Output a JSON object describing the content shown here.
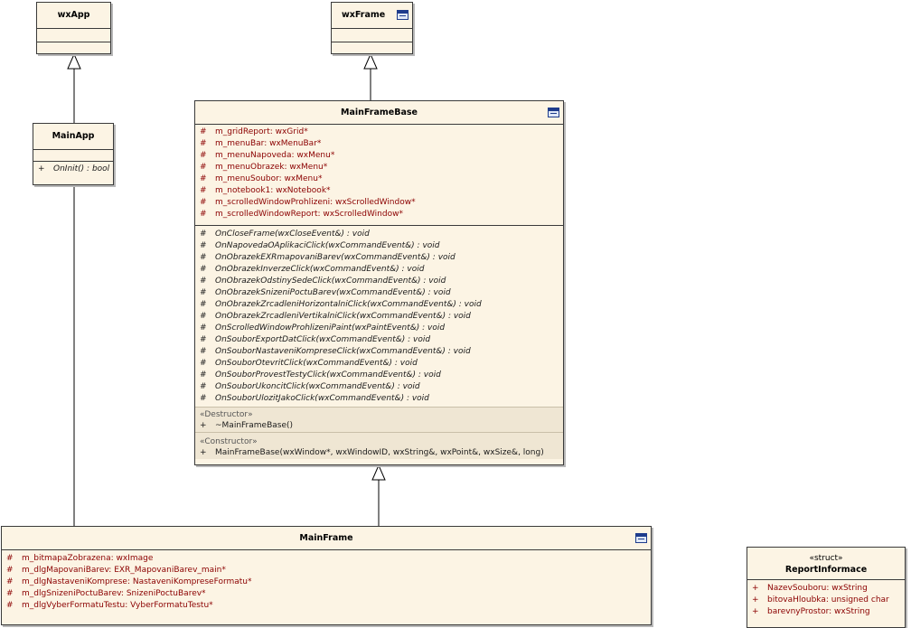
{
  "classes": {
    "wxapp": {
      "name": "wxApp"
    },
    "wxframe": {
      "name": "wxFrame"
    },
    "mainapp": {
      "name": "MainApp",
      "ops": [
        {
          "vis": "+",
          "text": "OnInit() : bool"
        }
      ]
    },
    "mainframebase": {
      "name": "MainFrameBase",
      "attrs": [
        {
          "vis": "#",
          "text": "m_gridReport:  wxGrid*"
        },
        {
          "vis": "#",
          "text": "m_menuBar:  wxMenuBar*"
        },
        {
          "vis": "#",
          "text": "m_menuNapoveda:  wxMenu*"
        },
        {
          "vis": "#",
          "text": "m_menuObrazek:  wxMenu*"
        },
        {
          "vis": "#",
          "text": "m_menuSoubor:  wxMenu*"
        },
        {
          "vis": "#",
          "text": "m_notebook1:  wxNotebook*"
        },
        {
          "vis": "#",
          "text": "m_scrolledWindowProhlizeni:  wxScrolledWindow*"
        },
        {
          "vis": "#",
          "text": "m_scrolledWindowReport:  wxScrolledWindow*"
        }
      ],
      "ops": [
        {
          "vis": "#",
          "text": "OnCloseFrame(wxCloseEvent&) : void"
        },
        {
          "vis": "#",
          "text": "OnNapovedaOAplikaciClick(wxCommandEvent&) : void"
        },
        {
          "vis": "#",
          "text": "OnObrazekEXRmapovaniBarev(wxCommandEvent&) : void"
        },
        {
          "vis": "#",
          "text": "OnObrazekInverzeClick(wxCommandEvent&) : void"
        },
        {
          "vis": "#",
          "text": "OnObrazekOdstinySedeClick(wxCommandEvent&) : void"
        },
        {
          "vis": "#",
          "text": "OnObrazekSnizeniPoctuBarev(wxCommandEvent&) : void"
        },
        {
          "vis": "#",
          "text": "OnObrazekZrcadleniHorizontalniClick(wxCommandEvent&) : void"
        },
        {
          "vis": "#",
          "text": "OnObrazekZrcadleniVertikalniClick(wxCommandEvent&) : void"
        },
        {
          "vis": "#",
          "text": "OnScrolledWindowProhlizeniPaint(wxPaintEvent&) : void"
        },
        {
          "vis": "#",
          "text": "OnSouborExportDatClick(wxCommandEvent&) : void"
        },
        {
          "vis": "#",
          "text": "OnSouborNastaveniKompreseClick(wxCommandEvent&) : void"
        },
        {
          "vis": "#",
          "text": "OnSouborOtevritClick(wxCommandEvent&) : void"
        },
        {
          "vis": "#",
          "text": "OnSouborProvestTestyClick(wxCommandEvent&) : void"
        },
        {
          "vis": "#",
          "text": "OnSouborUkoncitClick(wxCommandEvent&) : void"
        },
        {
          "vis": "#",
          "text": "OnSouborUlozitJakoClick(wxCommandEvent&) : void"
        }
      ],
      "destructor_label": "«Destructor»",
      "destructor": {
        "vis": "+",
        "text": "~MainFrameBase()"
      },
      "constructor_label": "«Constructor»",
      "constructor": {
        "vis": "+",
        "text": "MainFrameBase(wxWindow*, wxWindowID, wxString&, wxPoint&, wxSize&, long)"
      }
    },
    "mainframe": {
      "name": "MainFrame",
      "attrs": [
        {
          "vis": "#",
          "text": "m_bitmapaZobrazena:  wxImage"
        },
        {
          "vis": "#",
          "text": "m_dlgMapovaniBarev:  EXR_MapovaniBarev_main*"
        },
        {
          "vis": "#",
          "text": "m_dlgNastaveniKomprese:  NastaveniKompreseFormatu*"
        },
        {
          "vis": "#",
          "text": "m_dlgSnizeniPoctuBarev:  SnizeniPoctuBarev*"
        },
        {
          "vis": "#",
          "text": "m_dlgVyberFormatuTestu:  VyberFormatuTestu*"
        }
      ]
    },
    "reportinformace": {
      "stereotype": "«struct»",
      "name": "ReportInformace",
      "attrs": [
        {
          "vis": "+",
          "text": "NazevSouboru:  wxString"
        },
        {
          "vis": "+",
          "text": "bitovaHloubka:  unsigned char"
        },
        {
          "vis": "+",
          "text": "barevnyProstor:  wxString"
        }
      ]
    }
  },
  "icons": {
    "class_window": "window-icon"
  },
  "colors": {
    "class_fill": "#fcf4e4",
    "attribute_text": "#8b0000",
    "icon_blue": "#1e3c8c"
  }
}
